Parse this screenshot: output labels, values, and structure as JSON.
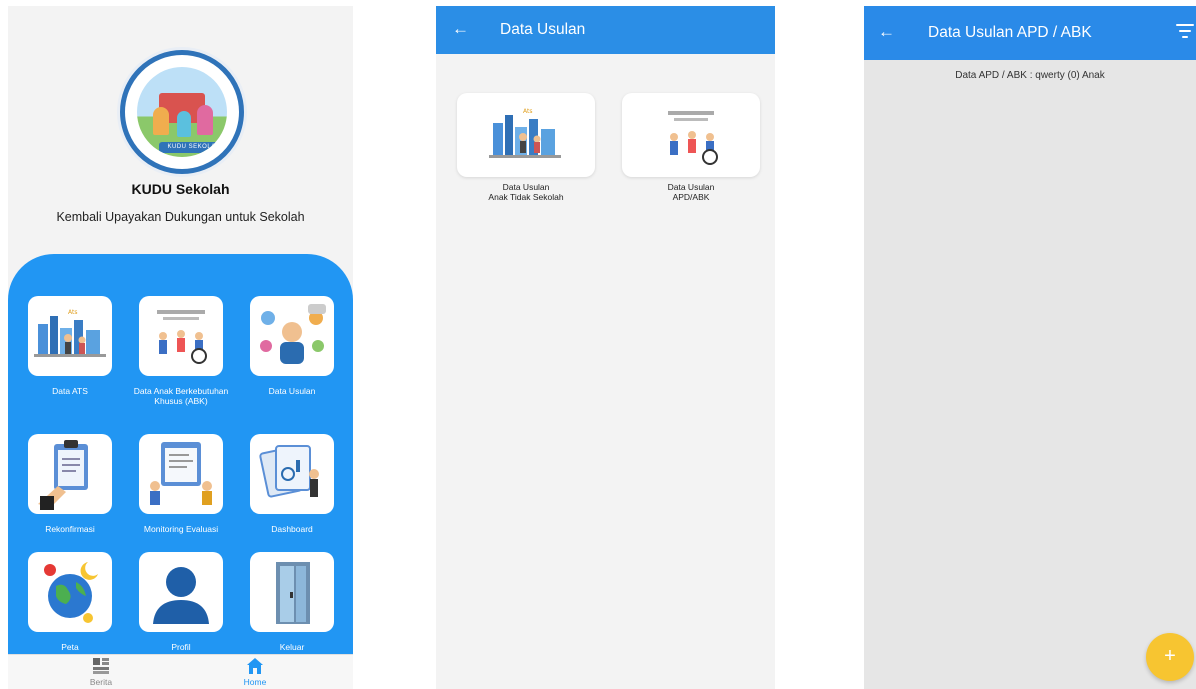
{
  "home": {
    "app_title": "KUDU Sekolah",
    "app_subtitle": "Kembali Upayakan Dukungan untuk Sekolah",
    "logo_text": "KUDU SEKOLAH",
    "menu": [
      {
        "label": "Data ATS",
        "icon": "city-children-illustration-icon"
      },
      {
        "label": "Data Anak Berkebutuhan Khusus (ABK)",
        "icon": "disabled-children-illustration-icon"
      },
      {
        "label": "Data Usulan",
        "icon": "proposal-people-icon"
      },
      {
        "label": "Rekonfirmasi",
        "icon": "clipboard-check-icon"
      },
      {
        "label": "Monitoring Evaluasi",
        "icon": "monitoring-board-icon"
      },
      {
        "label": "Dashboard",
        "icon": "dashboard-charts-icon"
      },
      {
        "label": "Peta",
        "icon": "globe-map-icon"
      },
      {
        "label": "Profil",
        "icon": "user-profile-icon"
      },
      {
        "label": "Keluar",
        "icon": "exit-door-icon"
      }
    ],
    "bottom_nav": [
      {
        "label": "Berita",
        "icon": "news-grid-icon",
        "active": false
      },
      {
        "label": "Home",
        "icon": "home-icon",
        "active": true
      }
    ]
  },
  "usulan": {
    "title": "Data Usulan",
    "cards": [
      {
        "label_line1": "Data Usulan",
        "label_line2": "Anak Tidak Sekolah"
      },
      {
        "label_line1": "Data Usulan",
        "label_line2": "APD/ABK"
      }
    ]
  },
  "usulan_apd": {
    "title": "Data Usulan APD / ABK",
    "summary": "Data APD / ABK : qwerty (0) Anak",
    "fab_label": "+"
  },
  "colors": {
    "primary": "#2196f3",
    "appbar": "#2b8ee6",
    "fab": "#f7c531"
  }
}
